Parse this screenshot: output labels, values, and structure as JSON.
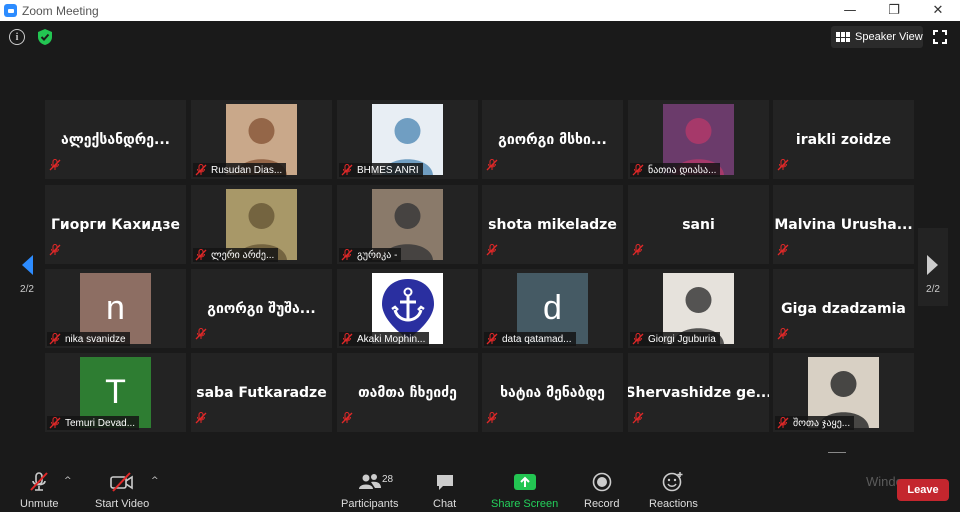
{
  "window": {
    "title": "Zoom Meeting",
    "controls": [
      "—",
      "❐",
      "✕"
    ]
  },
  "header": {
    "speaker_view_label": "Speaker View"
  },
  "nav": {
    "page_indicator": "2/2"
  },
  "tiles": [
    {
      "name": "ალექსანდრე...",
      "label": "",
      "avatar": null
    },
    {
      "name": "",
      "label": "Rusudan Dias...",
      "avatar": {
        "type": "photo",
        "color": "#8b5a3c",
        "bg": "#c9a88a"
      }
    },
    {
      "name": "",
      "label": "BHMES ANRI",
      "avatar": {
        "type": "photo",
        "color": "#5a8fb8",
        "bg": "#e8eef4"
      }
    },
    {
      "name": "გიორგი მსხი...",
      "label": "",
      "avatar": null
    },
    {
      "name": "",
      "label": "ნათია დიასა...",
      "avatar": {
        "type": "photo",
        "color": "#b03a6a",
        "bg": "#6b3b6b"
      }
    },
    {
      "name": "irakli zoidze",
      "label": "",
      "avatar": null
    },
    {
      "name": "Гиорги Кахидзе",
      "label": "",
      "avatar": null
    },
    {
      "name": "",
      "label": "ლერი არძე...",
      "avatar": {
        "type": "photo",
        "color": "#6b5a3a",
        "bg": "#a89868"
      }
    },
    {
      "name": "",
      "label": "გურიკა -",
      "avatar": {
        "type": "photo",
        "color": "#3a3a3a",
        "bg": "#8a7a6a"
      }
    },
    {
      "name": "shota mikeladze",
      "label": "",
      "avatar": null
    },
    {
      "name": "sani",
      "label": "",
      "avatar": null
    },
    {
      "name": "Malvina  Urusha...",
      "label": "",
      "avatar": null
    },
    {
      "name": "",
      "label": "nika svanidze",
      "avatar": {
        "type": "letter",
        "letter": "n",
        "bg": "#8d6e63"
      }
    },
    {
      "name": "გიორგი შუშა...",
      "label": "",
      "avatar": null
    },
    {
      "name": "",
      "label": "Akaki Mophin...",
      "avatar": {
        "type": "anchor",
        "bg": "#2a2fa0"
      }
    },
    {
      "name": "",
      "label": "data qatamad...",
      "avatar": {
        "type": "letter",
        "letter": "d",
        "bg": "#455a64"
      }
    },
    {
      "name": "",
      "label": "Giorgi Jguburia",
      "avatar": {
        "type": "photo",
        "color": "#3a3a3a",
        "bg": "#e6e2dc"
      }
    },
    {
      "name": "Giga dzadzamia",
      "label": "",
      "avatar": null
    },
    {
      "name": "",
      "label": "Temuri Devad...",
      "avatar": {
        "type": "letter",
        "letter": "T",
        "bg": "#2e7d32"
      }
    },
    {
      "name": "saba Futkaradze",
      "label": "",
      "avatar": null
    },
    {
      "name": "თამთა ჩხეიძე",
      "label": "",
      "avatar": null
    },
    {
      "name": "ხატია მენაბდე",
      "label": "",
      "avatar": null
    },
    {
      "name": "Shervashidze  ge...",
      "label": "",
      "avatar": null
    },
    {
      "name": "",
      "label": "შოთა ჯაყე...",
      "avatar": {
        "type": "photo",
        "color": "#2e2e2e",
        "bg": "#d8d0c4"
      }
    }
  ],
  "toolbar": {
    "unmute_label": "Unmute",
    "start_video_label": "Start Video",
    "participants_label": "Participants",
    "participants_count": "28",
    "chat_label": "Chat",
    "share_label": "Share Screen",
    "record_label": "Record",
    "reactions_label": "Reactions",
    "leave_label": "Leave"
  },
  "watermark": "Windows",
  "colors": {
    "share_green": "#23c552",
    "leave_red": "#c4262e",
    "muted_red": "#e02828",
    "speaker_blue": "#2d8cff"
  }
}
